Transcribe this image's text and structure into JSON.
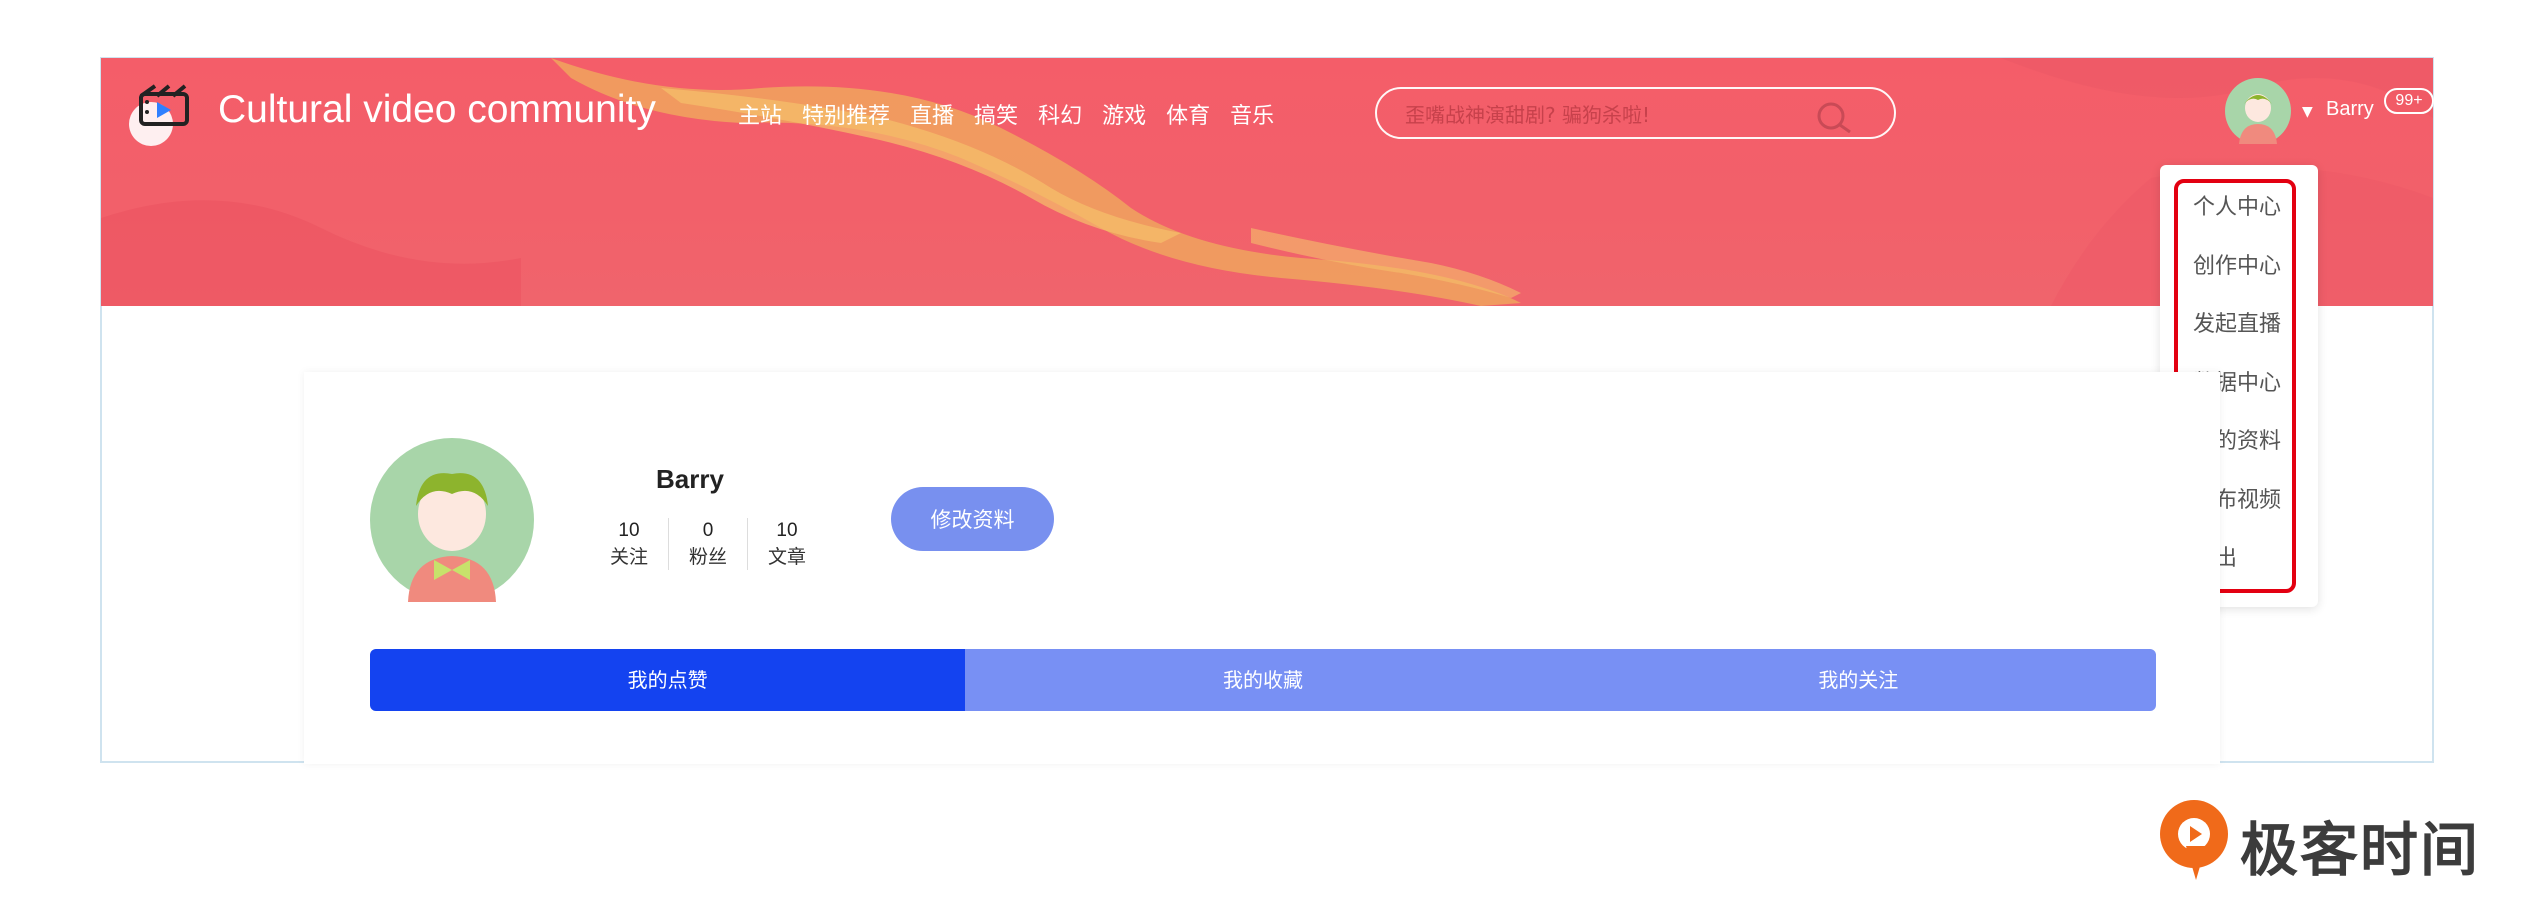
{
  "app": {
    "title": "Cultural video community"
  },
  "nav": {
    "items": [
      "主站",
      "特别推荐",
      "直播",
      "搞笑",
      "科幻",
      "游戏",
      "体育",
      "音乐"
    ]
  },
  "search": {
    "placeholder": "歪嘴战神演甜剧? 骗狗杀啦!"
  },
  "user": {
    "name": "Barry",
    "badge": "99+"
  },
  "dropdown": {
    "items": [
      "个人中心",
      "创作中心",
      "发起直播",
      "数据中心",
      "我的资料",
      "发布视频",
      "退出"
    ]
  },
  "profile": {
    "name": "Barry",
    "stats": [
      {
        "value": "10",
        "label": "关注"
      },
      {
        "value": "0",
        "label": "粉丝"
      },
      {
        "value": "10",
        "label": "文章"
      }
    ],
    "edit_label": "修改资料"
  },
  "tabs": [
    {
      "label": "我的点赞",
      "active": true
    },
    {
      "label": "我的收藏",
      "active": false
    },
    {
      "label": "我的关注",
      "active": false
    }
  ],
  "watermark": {
    "text": "极客时间"
  },
  "colors": {
    "banner": "#f45d69",
    "tab_active": "#1443f0",
    "tab_inactive": "#7890f4",
    "highlight": "#e30011"
  }
}
